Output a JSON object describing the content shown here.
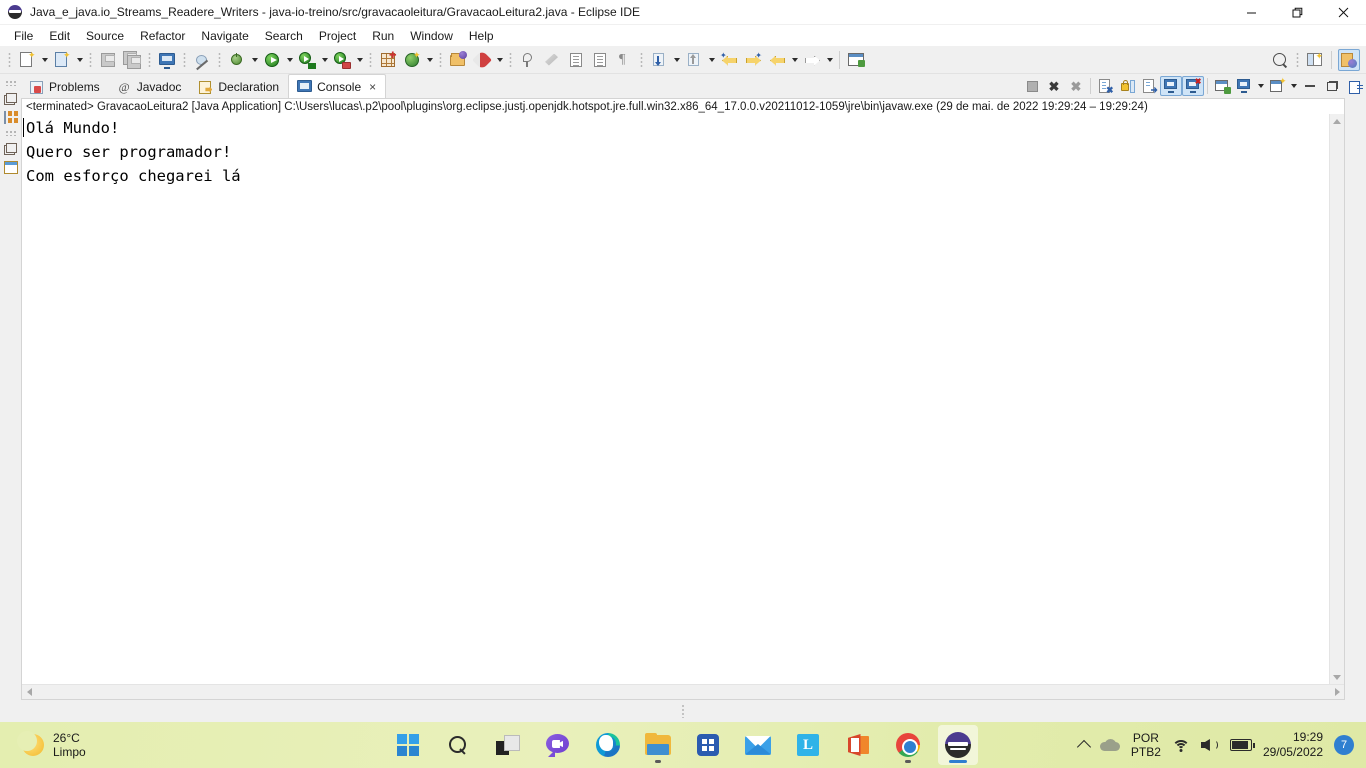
{
  "window": {
    "title": "Java_e_java.io_Streams_Readere_Writers - java-io-treino/src/gravacaoleitura/GravacaoLeitura2.java - Eclipse IDE",
    "app_icon": "eclipse-icon",
    "controls": {
      "minimize": "minimize-icon",
      "restore": "restore-icon",
      "close": "close-icon"
    }
  },
  "menubar": [
    {
      "label": "File"
    },
    {
      "label": "Edit"
    },
    {
      "label": "Source"
    },
    {
      "label": "Refactor"
    },
    {
      "label": "Navigate"
    },
    {
      "label": "Search"
    },
    {
      "label": "Project"
    },
    {
      "label": "Run"
    },
    {
      "label": "Window"
    },
    {
      "label": "Help"
    }
  ],
  "toolbar": {
    "items": [
      {
        "name": "new-wizard-button",
        "icon": "new-file-icon"
      },
      {
        "name": "new-java-class-button",
        "icon": "new-class-icon"
      },
      {
        "name": "save-button",
        "icon": "save-icon"
      },
      {
        "name": "save-all-button",
        "icon": "save-all-icon"
      },
      {
        "name": "open-console-button",
        "icon": "console-icon"
      },
      {
        "name": "skip-breakpoints-button",
        "icon": "skip-breakpoints-icon"
      },
      {
        "name": "debug-button",
        "icon": "debug-bug-icon"
      },
      {
        "name": "run-button",
        "icon": "run-green-play-icon"
      },
      {
        "name": "coverage-button",
        "icon": "coverage-icon"
      },
      {
        "name": "run-toolbox-button",
        "icon": "run-toolbox-icon"
      },
      {
        "name": "new-java-project-button",
        "icon": "new-project-icon"
      },
      {
        "name": "refresh-button",
        "icon": "refresh-icon"
      },
      {
        "name": "open-type-button",
        "icon": "open-type-icon"
      },
      {
        "name": "external-tools-button",
        "icon": "rocket-icon"
      },
      {
        "name": "search-button",
        "icon": "magnifier-icon"
      },
      {
        "name": "open-perspective-button",
        "icon": "open-perspective-icon"
      },
      {
        "name": "java-perspective-button",
        "icon": "java-perspective-icon"
      }
    ]
  },
  "view_tabs": [
    {
      "label": "Problems",
      "icon": "problems-icon",
      "active": false
    },
    {
      "label": "Javadoc",
      "icon": "javadoc-icon",
      "active": false
    },
    {
      "label": "Declaration",
      "icon": "declaration-icon",
      "active": false
    },
    {
      "label": "Console",
      "icon": "console-icon",
      "active": true,
      "close": "×"
    }
  ],
  "view_toolbar": [
    {
      "name": "terminate-button",
      "icon": "stop-square-icon"
    },
    {
      "name": "remove-launch-button",
      "icon": "remove-x-icon"
    },
    {
      "name": "remove-all-launches-button",
      "icon": "remove-all-x-icon"
    },
    {
      "name": "clear-console-button",
      "icon": "clear-console-icon"
    },
    {
      "name": "scroll-lock-button",
      "icon": "lock-icon"
    },
    {
      "name": "word-wrap-button",
      "icon": "word-wrap-icon"
    },
    {
      "name": "show-console-on-output-button",
      "icon": "show-console-icon",
      "toggled": true
    },
    {
      "name": "show-console-on-error-button",
      "icon": "show-console-error-icon",
      "toggled": true
    },
    {
      "name": "pin-console-button",
      "icon": "pin-console-icon"
    },
    {
      "name": "display-selected-console-button",
      "icon": "display-console-icon"
    },
    {
      "name": "open-console-button",
      "icon": "new-console-icon"
    },
    {
      "name": "minimize-view-button",
      "icon": "minimize-icon"
    },
    {
      "name": "maximize-view-button",
      "icon": "maximize-icon"
    }
  ],
  "left_trim": [
    {
      "name": "restore-view-top",
      "icon": "restore-icon"
    },
    {
      "name": "package-explorer-trim",
      "icon": "package-explorer-icon"
    },
    {
      "name": "restore-view-bottom",
      "icon": "restore-icon"
    },
    {
      "name": "outline-trim",
      "icon": "outline-icon"
    }
  ],
  "right_trim": [
    {
      "name": "task-list-trim",
      "icon": "task-list-icon"
    }
  ],
  "console": {
    "launch_prefix": "<terminated> GravacaoLeitura2 [Java Application] C:\\Users\\lucas\\.p2\\pool\\plugins\\org.eclipse.justj.openjdk.hotspot.jre.full.win32.x86_64_17.0.0.v20211012-1059\\jre\\bin\\javaw.exe",
    "launch_timestamp": "(29 de mai. de 2022 19:29:24 – 19:29:24)",
    "output_lines": [
      "Olá Mundo!",
      "Quero ser programador!",
      "Com esforço chegarei lá"
    ]
  },
  "taskbar": {
    "weather": {
      "temperature": "26°C",
      "condition": "Limpo",
      "icon": "moon-icon"
    },
    "apps": [
      {
        "name": "start-button",
        "icon": "windows-start-icon"
      },
      {
        "name": "search-taskbar-button",
        "icon": "search-icon"
      },
      {
        "name": "task-view-button",
        "icon": "task-view-icon"
      },
      {
        "name": "chat-button",
        "icon": "chat-icon"
      },
      {
        "name": "edge-button",
        "icon": "edge-icon"
      },
      {
        "name": "file-explorer-button",
        "icon": "folder-icon"
      },
      {
        "name": "microsoft-store-button",
        "icon": "store-icon"
      },
      {
        "name": "mail-button",
        "icon": "mail-icon"
      },
      {
        "name": "l-app-button",
        "icon": "l-app-icon"
      },
      {
        "name": "office-button",
        "icon": "office-icon"
      },
      {
        "name": "chrome-button",
        "icon": "chrome-icon",
        "running": true
      },
      {
        "name": "eclipse-taskbar-button",
        "icon": "eclipse-icon",
        "active": true
      }
    ],
    "tray": {
      "chevron": "chevron-up-icon",
      "onedrive": "cloud-icon",
      "language_top": "POR",
      "language_bottom": "PTB2",
      "wifi": "wifi-icon",
      "volume": "speaker-icon",
      "battery": "battery-icon",
      "time": "19:29",
      "date": "29/05/2022",
      "notification_count": "7"
    }
  }
}
